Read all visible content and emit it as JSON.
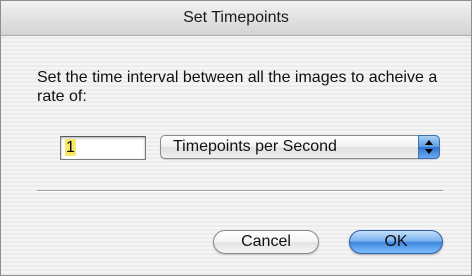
{
  "dialog": {
    "title": "Set Timepoints",
    "instructions": "Set the time interval between all the images to acheive a rate of:",
    "rate_input": {
      "value": "1"
    },
    "rate_unit_popup": {
      "selected": "Timepoints per Second"
    },
    "buttons": {
      "cancel_label": "Cancel",
      "ok_label": "OK"
    }
  },
  "colors": {
    "default_button": "#3d86e0",
    "text_selection": "#f7e86a"
  },
  "icons": {
    "popup_arrows": "up-down-arrows-icon"
  }
}
